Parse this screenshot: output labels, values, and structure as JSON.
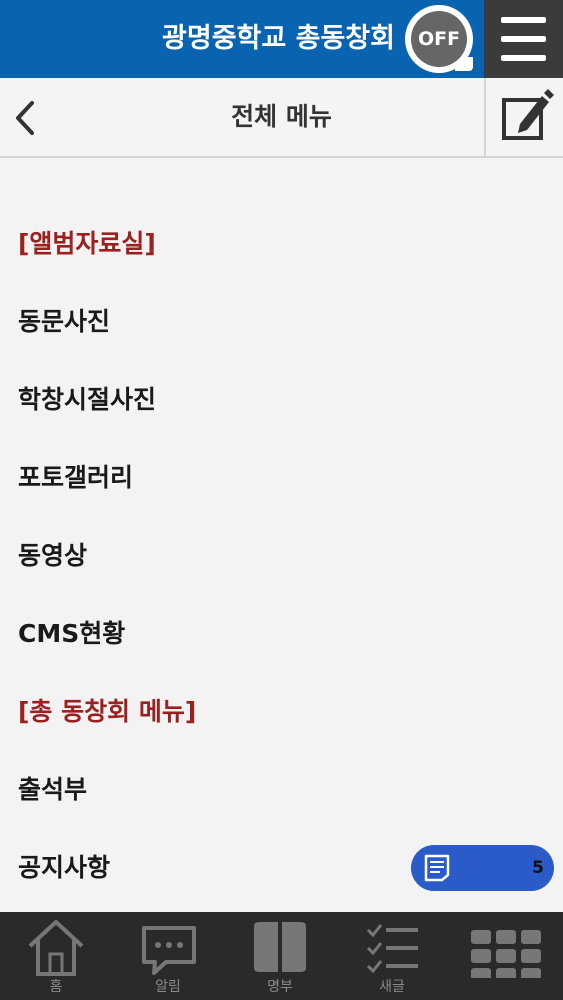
{
  "header": {
    "app_title": "광명중학교 총동창회",
    "off_badge": "OFF",
    "menu_icon": "hamburger-icon"
  },
  "subheader": {
    "title": "전체 메뉴",
    "back_icon": "chevron-left-icon",
    "edit_icon": "compose-icon"
  },
  "menu": {
    "items": [
      {
        "label": "[앨범자료실]",
        "type": "section"
      },
      {
        "label": "동문사진",
        "type": "link"
      },
      {
        "label": "학창시절사진",
        "type": "link"
      },
      {
        "label": "포토갤러리",
        "type": "link"
      },
      {
        "label": "동영상",
        "type": "link"
      },
      {
        "label": "CMS현황",
        "type": "link"
      },
      {
        "label": "[총 동창회 메뉴]",
        "type": "section"
      },
      {
        "label": "출석부",
        "type": "link"
      },
      {
        "label": "공지사항",
        "type": "link"
      }
    ]
  },
  "float_badge": {
    "count": "5",
    "icon": "document-list-icon"
  },
  "bottom_nav": {
    "items": [
      {
        "label": "홈",
        "icon": "home-icon"
      },
      {
        "label": "알림",
        "icon": "chat-bubble-icon"
      },
      {
        "label": "명부",
        "icon": "book-icon"
      },
      {
        "label": "새글",
        "icon": "checklist-icon"
      },
      {
        "label": "",
        "icon": "grid-icon"
      }
    ]
  },
  "colors": {
    "header_blue": "#0a63b0",
    "section_red": "#9b2020",
    "badge_blue": "#2b5bc8",
    "nav_dark": "#2a2a2a"
  }
}
